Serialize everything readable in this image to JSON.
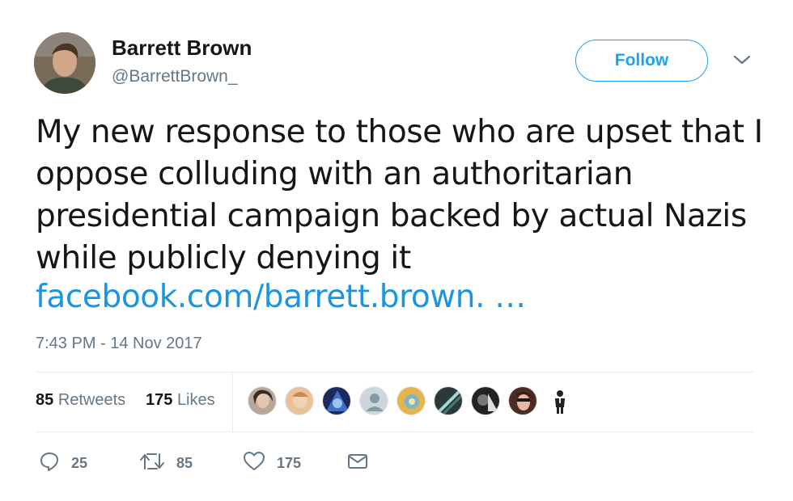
{
  "author": {
    "name": "Barrett Brown",
    "handle": "@BarrettBrown_"
  },
  "follow_label": "Follow",
  "tweet": {
    "text": "My new response to those who are upset that I oppose colluding with an authoritarian presidential campaign backed by actual Nazis while publicly denying it",
    "link": "facebook.com/barrett.brown. …",
    "timestamp": "7:43 PM - 14 Nov 2017"
  },
  "stats": {
    "retweets_count": "85",
    "retweets_label": "Retweets",
    "likes_count": "175",
    "likes_label": "Likes"
  },
  "actions": {
    "reply_count": "25",
    "retweet_count": "85",
    "like_count": "175"
  },
  "colors": {
    "accent": "#1da1f2",
    "link": "#1b95e0",
    "muted": "#657786",
    "divider": "#e6ecf0"
  },
  "icons": {
    "reply": "reply-icon",
    "retweet": "retweet-icon",
    "like": "heart-icon",
    "dm": "envelope-icon",
    "caret": "chevron-down-icon"
  }
}
